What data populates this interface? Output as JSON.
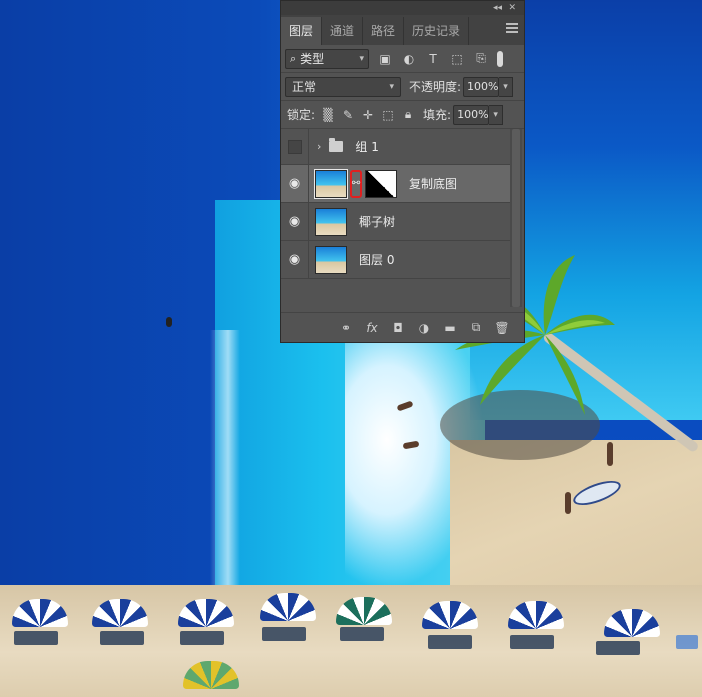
{
  "panel": {
    "tabs": [
      {
        "label": "图层",
        "active": true
      },
      {
        "label": "通道",
        "active": false
      },
      {
        "label": "路径",
        "active": false
      },
      {
        "label": "历史记录",
        "active": false
      }
    ],
    "collapse_glyph": "◂◂",
    "close_glyph": "✕",
    "filter": {
      "label": "类型",
      "icons": [
        "image-filter-icon",
        "adjustment-filter-icon",
        "text-filter-icon",
        "shape-filter-icon",
        "smart-object-filter-icon"
      ]
    },
    "blend": {
      "mode": "正常",
      "opacity_label": "不透明度:",
      "opacity": "100%"
    },
    "lock": {
      "label": "锁定:",
      "fill_label": "填充:",
      "fill": "100%"
    },
    "layers": [
      {
        "name": "组 1",
        "type": "group",
        "visible": false
      },
      {
        "name": "复制底图",
        "type": "masked",
        "visible": true,
        "selected": true
      },
      {
        "name": "椰子树",
        "type": "image",
        "visible": true
      },
      {
        "name": "图层 0",
        "type": "image",
        "visible": true
      }
    ],
    "bottom_icons": [
      "link-layers-icon",
      "fx-icon",
      "add-mask-icon",
      "adjustment-layer-icon",
      "new-group-icon",
      "new-layer-icon",
      "delete-layer-icon"
    ],
    "fx_label": "fx"
  },
  "colors": {
    "highlight": "#e02020",
    "panel_bg": "#535353"
  }
}
